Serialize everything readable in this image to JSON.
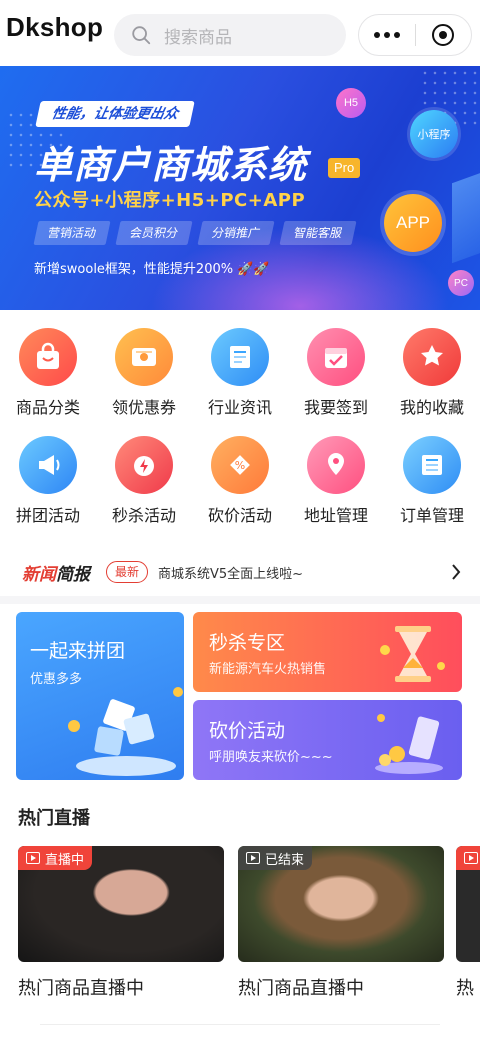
{
  "header": {
    "brand": "Dkshop",
    "search_placeholder": "搜索商品"
  },
  "banner": {
    "tag": "性能，让体验更出众",
    "title": "单商户商城系统",
    "pro_badge": "Pro",
    "subtitle": "公众号+小程序+H5+PC+APP",
    "chips": [
      "营销活动",
      "会员积分",
      "分销推广",
      "智能客服"
    ],
    "note": "新增swoole框架，性能提升200% 🚀🚀",
    "bubbles": {
      "h5": "H5",
      "miniprogram": "小程序",
      "app": "APP",
      "pc": "PC"
    }
  },
  "categories": [
    {
      "label": "商品分类",
      "icon": "shopping-bag-icon",
      "color": "#ff5a4a"
    },
    {
      "label": "领优惠券",
      "icon": "coupon-icon",
      "color": "#ff9a3a"
    },
    {
      "label": "行业资讯",
      "icon": "news-icon",
      "color": "#3aa5ff"
    },
    {
      "label": "我要签到",
      "icon": "calendar-check-icon",
      "color": "#ff5c8a"
    },
    {
      "label": "我的收藏",
      "icon": "star-box-icon",
      "color": "#ff4a4a"
    },
    {
      "label": "拼团活动",
      "icon": "megaphone-icon",
      "color": "#3a9cff"
    },
    {
      "label": "秒杀活动",
      "icon": "flash-alarm-icon",
      "color": "#ff4f4f"
    },
    {
      "label": "砍价活动",
      "icon": "discount-icon",
      "color": "#ff8a3a"
    },
    {
      "label": "地址管理",
      "icon": "map-pin-icon",
      "color": "#ff5c80"
    },
    {
      "label": "订单管理",
      "icon": "order-list-icon",
      "color": "#3aa8ff"
    }
  ],
  "news": {
    "logo_red": "新闻",
    "logo_dark": "简报",
    "badge": "最新",
    "text": "商城系统V5全面上线啦~"
  },
  "promos": {
    "group": {
      "title": "一起来拼团",
      "subtitle": "优惠多多"
    },
    "flash": {
      "title": "秒杀专区",
      "subtitle": "新能源汽车火热销售"
    },
    "bargain": {
      "title": "砍价活动",
      "subtitle": "呼朋唤友来砍价~~~"
    }
  },
  "live": {
    "section_title": "热门直播",
    "cards": [
      {
        "status": "直播中",
        "status_color": "#f0443a",
        "name": "热门商品直播中"
      },
      {
        "status": "已结束",
        "status_color": "#555555",
        "name": "热门商品直播中"
      },
      {
        "status": "",
        "status_color": "#f0443a",
        "name": "热"
      }
    ]
  }
}
